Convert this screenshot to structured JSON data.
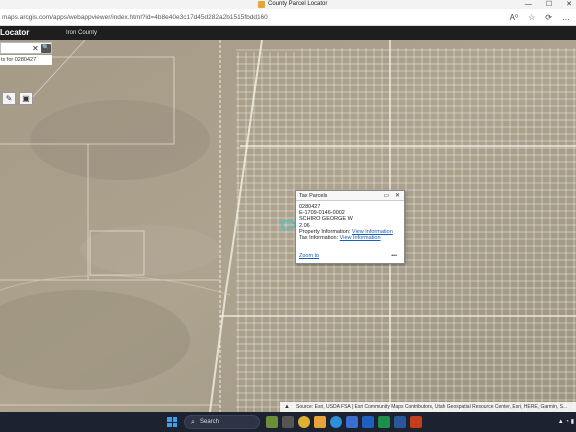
{
  "browser": {
    "tab_title": "County Parcel Locator",
    "url": "maps.arcgis.com/apps/webappviewer/index.html?id=4b8e40e3c17d45d282a2b1515fbdd160",
    "window_controls": [
      "—",
      "☐",
      "✕"
    ],
    "address_icons": [
      "A⁰",
      "☆",
      "⟳",
      "…"
    ]
  },
  "app": {
    "title": "Locator",
    "subtitle": "Iron County"
  },
  "search": {
    "clear_glyph": "✕",
    "button_glyph": "🔍",
    "result_text": "ts for 0280427"
  },
  "tools": [
    {
      "name": "draw-tool-button",
      "glyph": "✎"
    },
    {
      "name": "measure-tool-button",
      "glyph": "▣"
    }
  ],
  "popup": {
    "title": "Tax Parcels",
    "controls": "▭ ✕",
    "lines": [
      "0280427",
      "E-1709-0146-0002",
      "SCHIRO GEORGE W",
      "2.06"
    ],
    "property_label": "Property Information:",
    "property_link": "View Information",
    "tax_label": "Tax Information:",
    "tax_link": "View Information",
    "zoom_link": "Zoom to",
    "more": "•••"
  },
  "attribution": {
    "caret": "▲",
    "text": "Source: Esri, USDA FSA | Esri Community Maps Contributors, Utah Geospatial Resource Center, Esri, HERE, Garmin, S..."
  },
  "taskbar": {
    "search_label": "Search"
  },
  "colors": {
    "map_base": "#a99f8c",
    "grid_line": "#f4f0e4",
    "popup_link": "#1a5fb4",
    "highlight": "#3fc9c9"
  }
}
